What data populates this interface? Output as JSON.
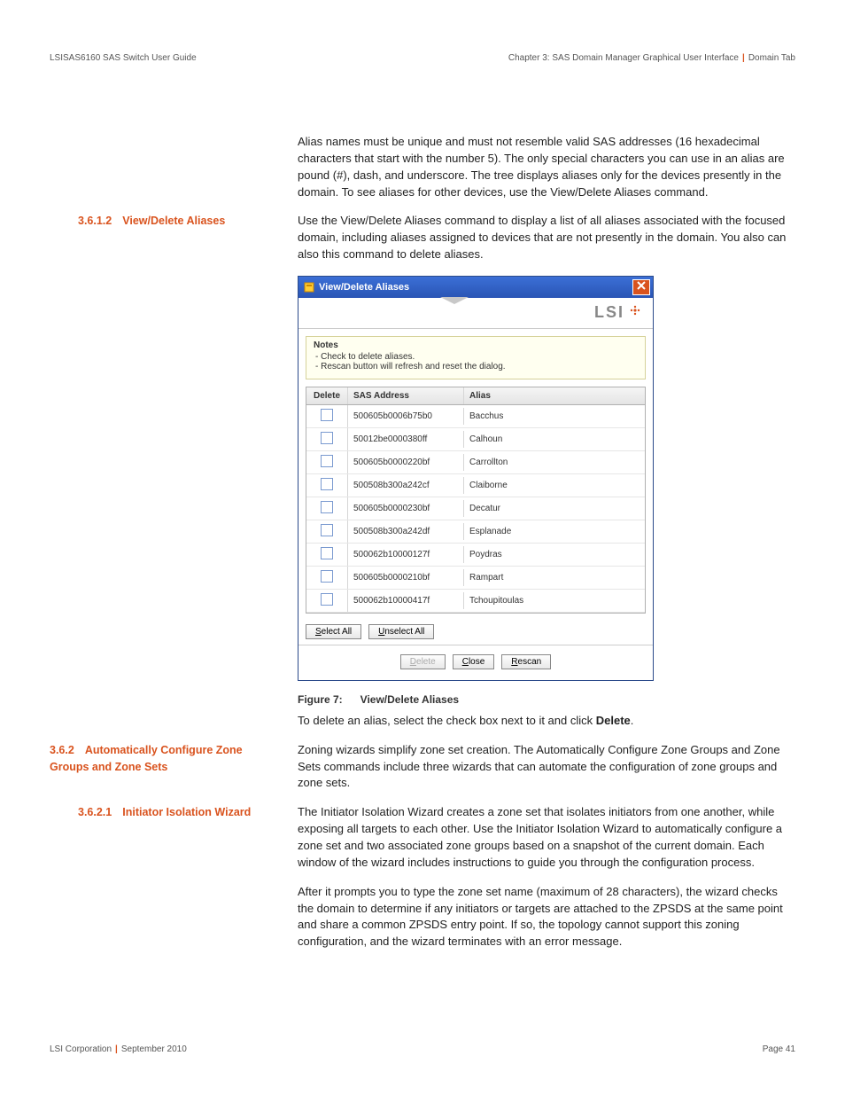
{
  "header": {
    "left": "LSISAS6160 SAS Switch User Guide",
    "right_chapter": "Chapter 3: SAS Domain Manager Graphical User Interface",
    "right_tab": "Domain Tab"
  },
  "intro_para": "Alias names must be unique and must not resemble valid SAS addresses (16 hexadecimal characters that start with the number 5). The only special characters you can use in an alias are pound (#), dash, and underscore. The tree displays aliases only for the devices presently in the domain. To see aliases for other devices, use the View/Delete Aliases command.",
  "sec_3612": {
    "num": "3.6.1.2",
    "title": "View/Delete Aliases",
    "para": "Use the View/Delete Aliases command to display a list of all aliases associated with the focused domain, including aliases assigned to devices that are not presently in the domain. You also can also this command to delete aliases."
  },
  "dialog": {
    "title": "View/Delete Aliases",
    "brand": "LSI",
    "notes_title": "Notes",
    "notes": [
      "- Check to delete aliases.",
      "- Rescan button will refresh and reset the dialog."
    ],
    "columns": {
      "delete": "Delete",
      "sas": "SAS Address",
      "alias": "Alias"
    },
    "rows": [
      {
        "sas": "500605b0006b75b0",
        "alias": "Bacchus"
      },
      {
        "sas": "50012be0000380ff",
        "alias": "Calhoun"
      },
      {
        "sas": "500605b0000220bf",
        "alias": "Carrollton"
      },
      {
        "sas": "500508b300a242cf",
        "alias": "Claiborne"
      },
      {
        "sas": "500605b0000230bf",
        "alias": "Decatur"
      },
      {
        "sas": "500508b300a242df",
        "alias": "Esplanade"
      },
      {
        "sas": "500062b10000127f",
        "alias": "Poydras"
      },
      {
        "sas": "500605b0000210bf",
        "alias": "Rampart"
      },
      {
        "sas": "500062b10000417f",
        "alias": "Tchoupitoulas"
      }
    ],
    "buttons": {
      "select_all_pre": "S",
      "select_all_rest": "elect All",
      "unselect_all_pre": "U",
      "unselect_all_rest": "nselect All",
      "delete_pre": "D",
      "delete_rest": "elete",
      "close_pre": "C",
      "close_rest": "lose",
      "rescan_pre": "R",
      "rescan_rest": "escan"
    }
  },
  "figure": {
    "num": "Figure 7:",
    "title": "View/Delete Aliases"
  },
  "after_fig_pre": "To delete an alias, select the check box next to it and click ",
  "after_fig_bold": "Delete",
  "after_fig_post": ".",
  "sec_362": {
    "num": "3.6.2",
    "title": "Automatically Configure Zone Groups and Zone Sets",
    "para": "Zoning wizards simplify zone set creation. The Automatically Configure Zone Groups and Zone Sets commands include three wizards that can automate the configuration of zone groups and zone sets."
  },
  "sec_3621": {
    "num": "3.6.2.1",
    "title": "Initiator Isolation Wizard",
    "para1": "The Initiator Isolation Wizard creates a zone set that isolates initiators from one another, while exposing all targets to each other. Use the Initiator Isolation Wizard to automatically configure a zone set and two associated zone groups based on a snapshot of the current domain. Each window of the wizard includes instructions to guide you through the configuration process.",
    "para2": "After it prompts you to type the zone set name (maximum of 28 characters), the wizard checks the domain to determine if any initiators or targets are attached to the ZPSDS at the same point and share a common ZPSDS entry point. If so, the topology cannot support this zoning configuration, and the wizard terminates with an error message."
  },
  "footer": {
    "left_a": "LSI Corporation",
    "left_b": "September 2010",
    "right": "Page 41"
  }
}
